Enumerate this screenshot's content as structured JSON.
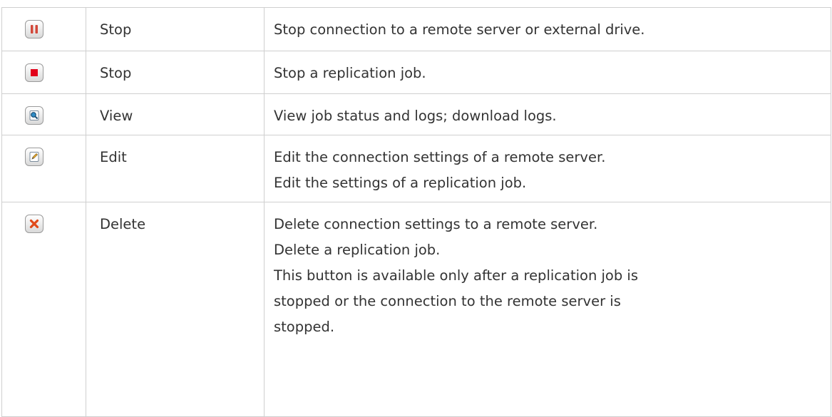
{
  "rows": [
    {
      "icon": "pause-icon",
      "name": "Stop",
      "description": [
        "Stop connection to a remote server or external drive."
      ]
    },
    {
      "icon": "stop-icon",
      "name": "Stop",
      "description": [
        "Stop a replication job."
      ]
    },
    {
      "icon": "view-icon",
      "name": "View",
      "description": [
        "View job status and logs; download logs."
      ]
    },
    {
      "icon": "edit-icon",
      "name": "Edit",
      "description": [
        "Edit the connection settings of a remote server.",
        "Edit the settings of a replication job."
      ]
    },
    {
      "icon": "delete-icon",
      "name": "Delete",
      "description": [
        "Delete connection settings to a remote server.",
        "Delete a replication job.",
        "This button is available only after a replication job is",
        "stopped or the connection to the remote server is",
        "stopped."
      ]
    }
  ]
}
